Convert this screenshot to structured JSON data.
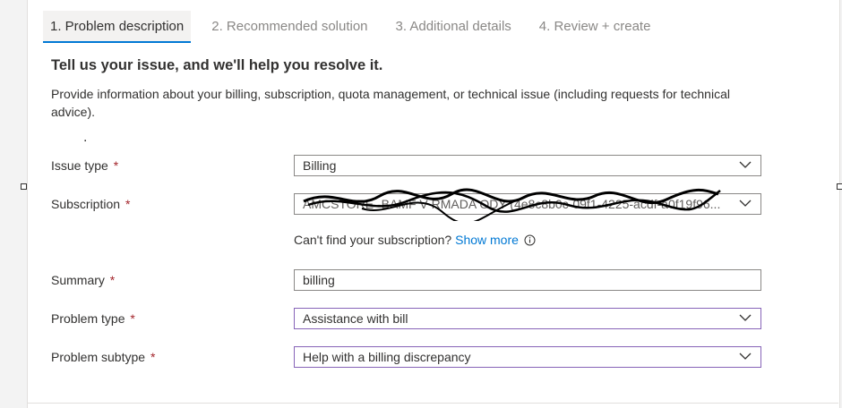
{
  "tabs": [
    {
      "label": "1. Problem description"
    },
    {
      "label": "2. Recommended solution"
    },
    {
      "label": "3. Additional details"
    },
    {
      "label": "4. Review + create"
    }
  ],
  "heading": "Tell us your issue, and we'll help you resolve it.",
  "description": "Provide information about your billing, subscription, quota management, or technical issue (including requests for technical advice).",
  "dot": ".",
  "required_marker": "*",
  "fields": {
    "issue_type": {
      "label": "Issue type",
      "value": "Billing"
    },
    "subscription": {
      "label": "Subscription",
      "value": "AMCSTORE -BAMF V RMADA ODY (4e8c8b0c-09f1-4225-acdf-a0f19f96..."
    },
    "summary": {
      "label": "Summary",
      "value": "billing"
    },
    "problem_type": {
      "label": "Problem type",
      "value": "Assistance with bill"
    },
    "problem_subtype": {
      "label": "Problem subtype",
      "value": "Help with a billing discrepancy"
    }
  },
  "subscription_help": {
    "text": "Can't find your subscription?",
    "link": "Show more"
  },
  "colors": {
    "accent": "#0078d4",
    "required": "#a4262c",
    "focused_border": "#8764b8"
  }
}
